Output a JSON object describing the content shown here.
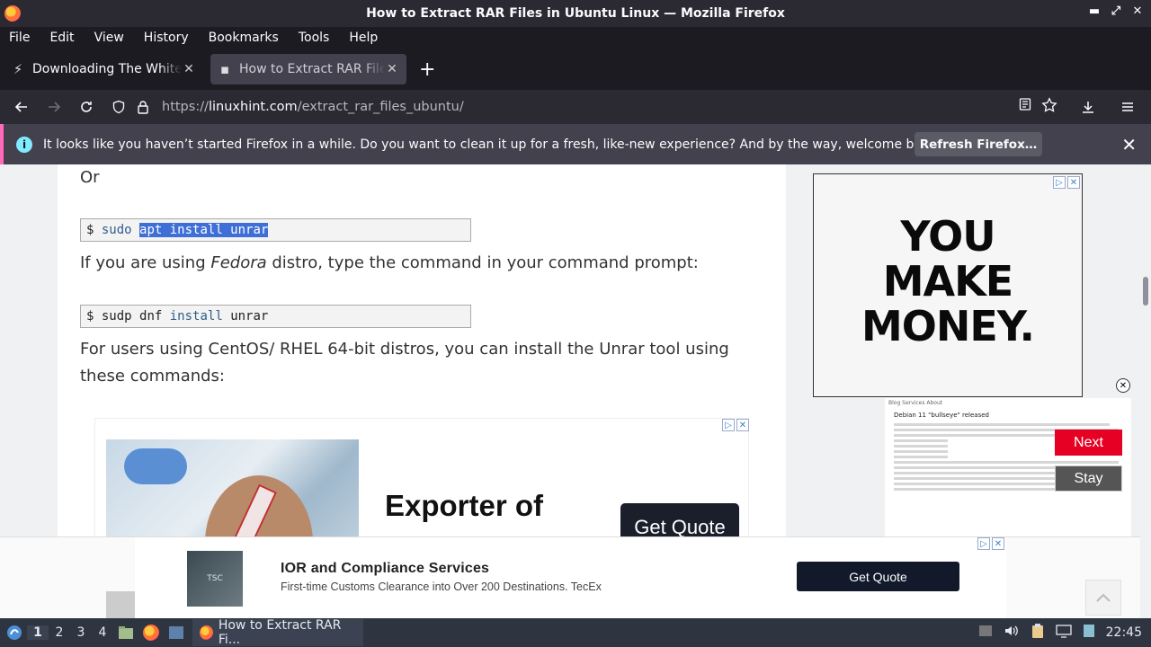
{
  "window": {
    "title": "How to Extract RAR Files in Ubuntu Linux — Mozilla Firefox",
    "controls": [
      "▬",
      "⤢",
      "✕"
    ]
  },
  "menu": [
    "File",
    "Edit",
    "View",
    "History",
    "Bookmarks",
    "Tools",
    "Help"
  ],
  "tabs": [
    {
      "label": "Downloading The White House",
      "icon": "⚡"
    },
    {
      "label": "How to Extract RAR Files in Ubuntu",
      "icon": "▪"
    }
  ],
  "nav": {
    "url_scheme": "https://",
    "url_domain": "linuxhint.com",
    "url_path": "/extract_rar_files_ubuntu/"
  },
  "notification": {
    "message": "It looks like you haven’t started Firefox in a while. Do you want to clean it up for a fresh, like-new experience? And by the way, welcome back!",
    "button": "Refresh Firefox…"
  },
  "article": {
    "or": "Or",
    "code1": {
      "prompt": "$",
      "cmd": "sudo",
      "selected": "apt install unrar"
    },
    "fedora_pre": "If you are using ",
    "fedora_em": "Fedora",
    "fedora_post": " distro, type the command in your command prompt:",
    "code2": {
      "prompt": "$",
      "cmd": "sudp dnf",
      "kw": "install",
      "arg": "unrar"
    },
    "centos_line1": "For users using CentOS/ RHEL 64-bit distros, you can install the Unrar tool using",
    "centos_line2": "these commands:"
  },
  "inline_ad": {
    "title": "Exporter of",
    "button": "Get Quote"
  },
  "side_ad": {
    "line1": "YOU",
    "line2": "MAKE",
    "line3": "MONEY."
  },
  "thumbnail": {
    "head": "Blog   Services   About",
    "title": "Debian 11 \"bullseye\" released",
    "next": "Next",
    "stay": "Stay"
  },
  "bottom_ad": {
    "logo": "TSC",
    "title": "IOR and Compliance Services",
    "subtitle": "First-time Customs Clearance into Over 200 Destinations. TecEx",
    "button": "Get Quote"
  },
  "taskbar": {
    "workspaces": [
      "1",
      "2",
      "3",
      "4"
    ],
    "task_label": "How to Extract RAR Fi...",
    "clock": "22:45"
  }
}
